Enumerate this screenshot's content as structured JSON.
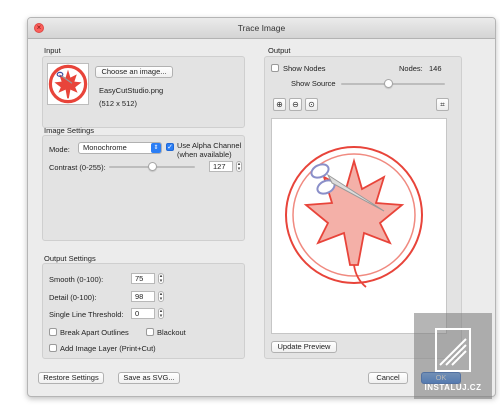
{
  "window": {
    "title": "Trace Image"
  },
  "input": {
    "section_label": "Input",
    "choose_button": "Choose an image...",
    "filename": "EasyCutStudio.png",
    "dimensions": "(512 x 512)",
    "thumbnail_icon": "maple-leaf-scissors-logo"
  },
  "image_settings": {
    "section_label": "Image Settings",
    "mode_label": "Mode:",
    "mode_value": "Monochrome",
    "alpha_label": "Use Alpha Channel",
    "alpha_sublabel": "(when available)",
    "alpha_checked": true,
    "contrast_label": "Contrast (0-255):",
    "contrast_value": "127",
    "contrast_fraction": 0.5
  },
  "output_settings": {
    "section_label": "Output Settings",
    "smooth_label": "Smooth (0-100):",
    "smooth_value": "75",
    "detail_label": "Detail (0-100):",
    "detail_value": "98",
    "threshold_label": "Single Line Threshold:",
    "threshold_value": "0",
    "break_apart_label": "Break Apart Outlines",
    "blackout_label": "Blackout",
    "add_layer_label": "Add Image Layer (Print+Cut)"
  },
  "output": {
    "section_label": "Output",
    "show_nodes_label": "Show Nodes",
    "nodes_label": "Nodes:",
    "nodes_value": "146",
    "show_source_label": "Show Source",
    "show_source_fraction": 0.45,
    "update_preview": "Update Preview"
  },
  "footer": {
    "restore": "Restore Settings",
    "save_svg": "Save as SVG...",
    "cancel": "Cancel",
    "ok": "OK"
  },
  "watermark": {
    "text": "INSTALUJ.CZ"
  },
  "colors": {
    "accent": "#2b7ef5",
    "logo_red": "#e8443a",
    "logo_fill": "#f2a49b"
  }
}
